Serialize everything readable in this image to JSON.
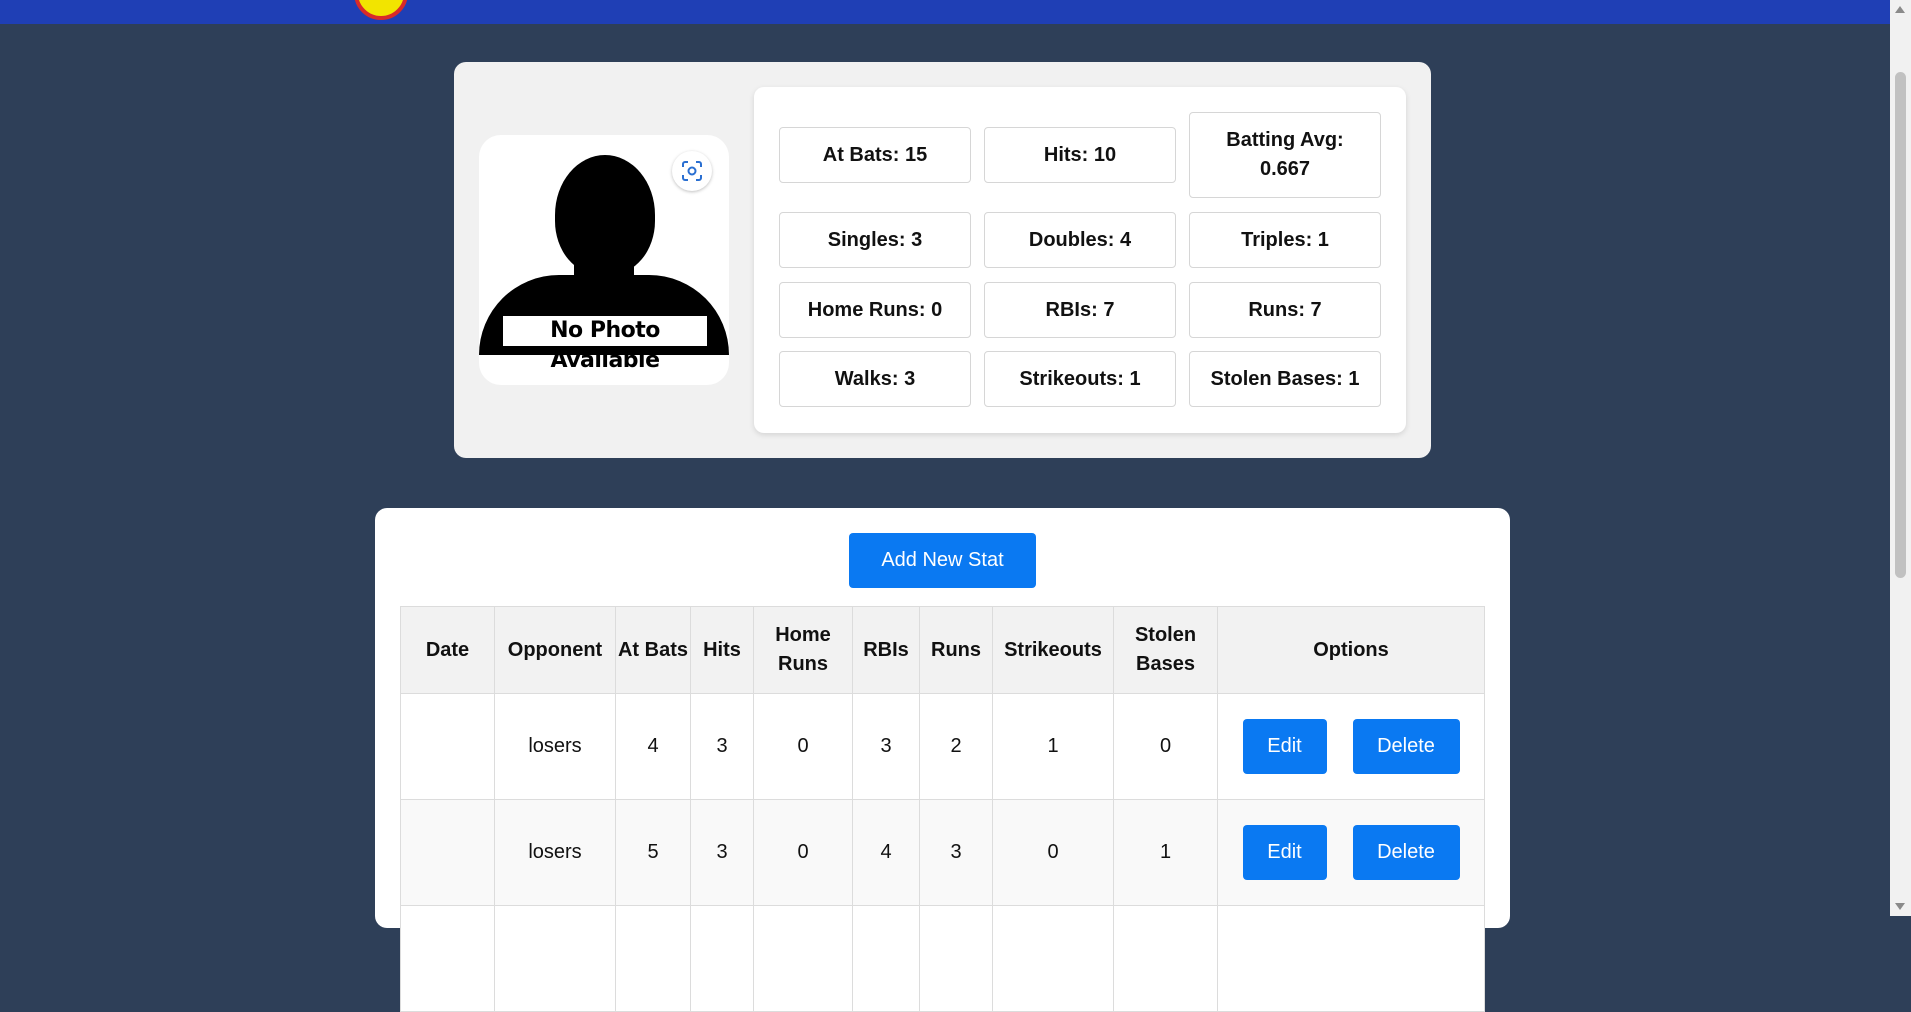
{
  "profile": {
    "photo_label": "No Photo Available",
    "lens_icon": "visual-search-icon",
    "stats": [
      {
        "label": "At Bats: 15"
      },
      {
        "label": "Hits: 10"
      },
      {
        "label": "Batting Avg: 0.667"
      },
      {
        "label": "Singles: 3"
      },
      {
        "label": "Doubles: 4"
      },
      {
        "label": "Triples: 1"
      },
      {
        "label": "Home Runs: 0"
      },
      {
        "label": "RBIs: 7"
      },
      {
        "label": "Runs: 7"
      },
      {
        "label": "Walks: 3"
      },
      {
        "label": "Strikeouts: 1"
      },
      {
        "label": "Stolen Bases: 1"
      }
    ]
  },
  "stats_table": {
    "add_button": "Add New Stat",
    "headers": [
      "Date",
      "Opponent",
      "At Bats",
      "Hits",
      "Home Runs",
      "RBIs",
      "Runs",
      "Strikeouts",
      "Stolen Bases",
      "Options"
    ],
    "rows": [
      {
        "date": "",
        "opponent": "losers",
        "at_bats": "4",
        "hits": "3",
        "home_runs": "0",
        "rbis": "3",
        "runs": "2",
        "strikeouts": "1",
        "stolen_bases": "0",
        "edit": "Edit",
        "delete": "Delete"
      },
      {
        "date": "",
        "opponent": "losers",
        "at_bats": "5",
        "hits": "3",
        "home_runs": "0",
        "rbis": "4",
        "runs": "3",
        "strikeouts": "0",
        "stolen_bases": "1",
        "edit": "Edit",
        "delete": "Delete"
      }
    ]
  },
  "colors": {
    "page_bg": "#2e3f58",
    "topbar": "#1f3fb5",
    "button": "#0a79f2"
  }
}
